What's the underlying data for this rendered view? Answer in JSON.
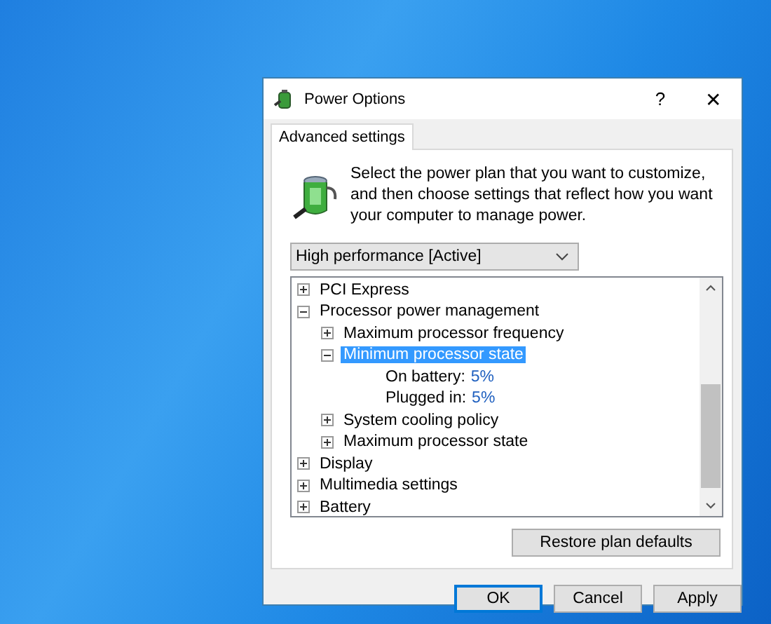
{
  "window": {
    "title": "Power Options",
    "help_button": "?",
    "close_button": "✕"
  },
  "tabs": [
    {
      "label": "Advanced settings",
      "selected": true
    }
  ],
  "description": "Select the power plan that you want to customize, and then choose settings that reflect how you want your computer to manage power.",
  "plan_dropdown": {
    "value": "High performance [Active]"
  },
  "settings_tree": [
    {
      "kind": "group",
      "label": "PCI Express",
      "expanded": false,
      "selected": false
    },
    {
      "kind": "group",
      "label": "Processor power management",
      "expanded": true,
      "selected": false,
      "children": [
        {
          "kind": "group",
          "label": "Maximum processor frequency",
          "expanded": false,
          "selected": false
        },
        {
          "kind": "group",
          "label": "Minimum processor state",
          "expanded": true,
          "selected": true,
          "children": [
            {
              "kind": "value",
              "label": "On battery:",
              "value": "5%"
            },
            {
              "kind": "value",
              "label": "Plugged in:",
              "value": "5%"
            }
          ]
        },
        {
          "kind": "group",
          "label": "System cooling policy",
          "expanded": false,
          "selected": false
        },
        {
          "kind": "group",
          "label": "Maximum processor state",
          "expanded": false,
          "selected": false
        }
      ]
    },
    {
      "kind": "group",
      "label": "Display",
      "expanded": false,
      "selected": false
    },
    {
      "kind": "group",
      "label": "Multimedia settings",
      "expanded": false,
      "selected": false
    },
    {
      "kind": "group",
      "label": "Battery",
      "expanded": false,
      "selected": false
    }
  ],
  "restore_button": "Restore plan defaults",
  "buttons": [
    {
      "label": "OK",
      "default": true
    },
    {
      "label": "Cancel",
      "default": false
    },
    {
      "label": "Apply",
      "default": false
    }
  ]
}
